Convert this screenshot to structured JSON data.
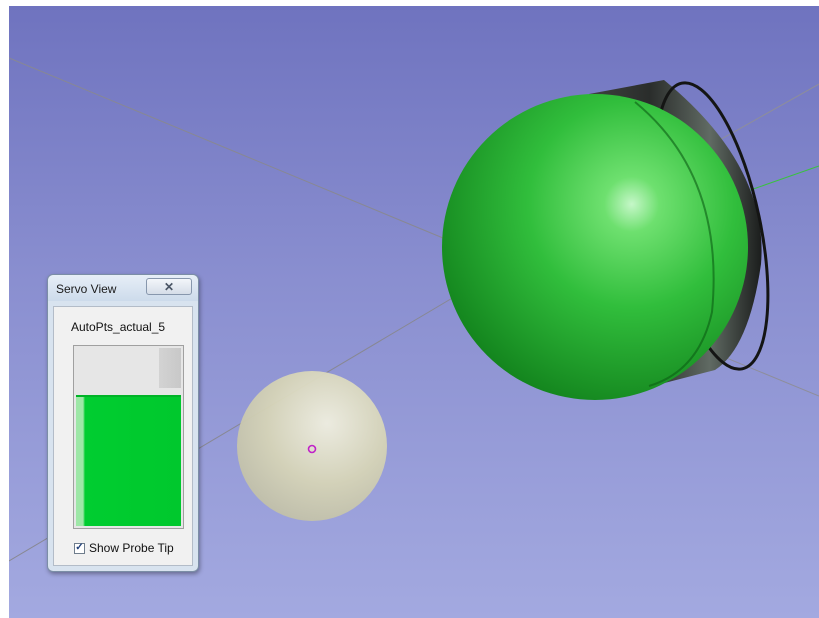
{
  "servo_window": {
    "title": "Servo View",
    "close_label": "✕",
    "point_name": "AutoPts_actual_5",
    "servo_level": 0.73,
    "show_probe_tip": {
      "label": "Show Probe Tip",
      "checked": true,
      "check_glyph": "✓"
    }
  },
  "scene": {
    "background_top": "#6f73bf",
    "background_bottom": "#a3a9e0",
    "target_color": "#2fbd3c",
    "probe_color": "#d8d6b6",
    "cylinder_color": "#252826",
    "marker_color": "#c020c8"
  }
}
